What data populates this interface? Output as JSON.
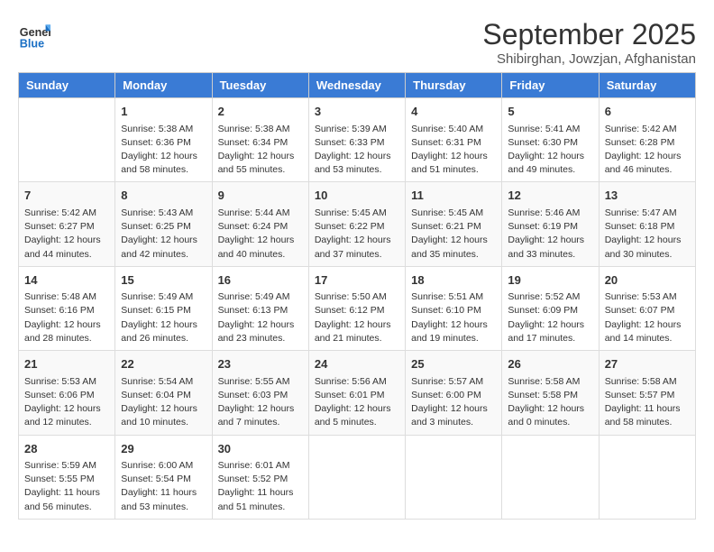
{
  "header": {
    "logo_general": "General",
    "logo_blue": "Blue",
    "month_title": "September 2025",
    "subtitle": "Shibirghan, Jowzjan, Afghanistan"
  },
  "weekdays": [
    "Sunday",
    "Monday",
    "Tuesday",
    "Wednesday",
    "Thursday",
    "Friday",
    "Saturday"
  ],
  "weeks": [
    [
      {
        "day": "",
        "info": ""
      },
      {
        "day": "1",
        "info": "Sunrise: 5:38 AM\nSunset: 6:36 PM\nDaylight: 12 hours\nand 58 minutes."
      },
      {
        "day": "2",
        "info": "Sunrise: 5:38 AM\nSunset: 6:34 PM\nDaylight: 12 hours\nand 55 minutes."
      },
      {
        "day": "3",
        "info": "Sunrise: 5:39 AM\nSunset: 6:33 PM\nDaylight: 12 hours\nand 53 minutes."
      },
      {
        "day": "4",
        "info": "Sunrise: 5:40 AM\nSunset: 6:31 PM\nDaylight: 12 hours\nand 51 minutes."
      },
      {
        "day": "5",
        "info": "Sunrise: 5:41 AM\nSunset: 6:30 PM\nDaylight: 12 hours\nand 49 minutes."
      },
      {
        "day": "6",
        "info": "Sunrise: 5:42 AM\nSunset: 6:28 PM\nDaylight: 12 hours\nand 46 minutes."
      }
    ],
    [
      {
        "day": "7",
        "info": "Sunrise: 5:42 AM\nSunset: 6:27 PM\nDaylight: 12 hours\nand 44 minutes."
      },
      {
        "day": "8",
        "info": "Sunrise: 5:43 AM\nSunset: 6:25 PM\nDaylight: 12 hours\nand 42 minutes."
      },
      {
        "day": "9",
        "info": "Sunrise: 5:44 AM\nSunset: 6:24 PM\nDaylight: 12 hours\nand 40 minutes."
      },
      {
        "day": "10",
        "info": "Sunrise: 5:45 AM\nSunset: 6:22 PM\nDaylight: 12 hours\nand 37 minutes."
      },
      {
        "day": "11",
        "info": "Sunrise: 5:45 AM\nSunset: 6:21 PM\nDaylight: 12 hours\nand 35 minutes."
      },
      {
        "day": "12",
        "info": "Sunrise: 5:46 AM\nSunset: 6:19 PM\nDaylight: 12 hours\nand 33 minutes."
      },
      {
        "day": "13",
        "info": "Sunrise: 5:47 AM\nSunset: 6:18 PM\nDaylight: 12 hours\nand 30 minutes."
      }
    ],
    [
      {
        "day": "14",
        "info": "Sunrise: 5:48 AM\nSunset: 6:16 PM\nDaylight: 12 hours\nand 28 minutes."
      },
      {
        "day": "15",
        "info": "Sunrise: 5:49 AM\nSunset: 6:15 PM\nDaylight: 12 hours\nand 26 minutes."
      },
      {
        "day": "16",
        "info": "Sunrise: 5:49 AM\nSunset: 6:13 PM\nDaylight: 12 hours\nand 23 minutes."
      },
      {
        "day": "17",
        "info": "Sunrise: 5:50 AM\nSunset: 6:12 PM\nDaylight: 12 hours\nand 21 minutes."
      },
      {
        "day": "18",
        "info": "Sunrise: 5:51 AM\nSunset: 6:10 PM\nDaylight: 12 hours\nand 19 minutes."
      },
      {
        "day": "19",
        "info": "Sunrise: 5:52 AM\nSunset: 6:09 PM\nDaylight: 12 hours\nand 17 minutes."
      },
      {
        "day": "20",
        "info": "Sunrise: 5:53 AM\nSunset: 6:07 PM\nDaylight: 12 hours\nand 14 minutes."
      }
    ],
    [
      {
        "day": "21",
        "info": "Sunrise: 5:53 AM\nSunset: 6:06 PM\nDaylight: 12 hours\nand 12 minutes."
      },
      {
        "day": "22",
        "info": "Sunrise: 5:54 AM\nSunset: 6:04 PM\nDaylight: 12 hours\nand 10 minutes."
      },
      {
        "day": "23",
        "info": "Sunrise: 5:55 AM\nSunset: 6:03 PM\nDaylight: 12 hours\nand 7 minutes."
      },
      {
        "day": "24",
        "info": "Sunrise: 5:56 AM\nSunset: 6:01 PM\nDaylight: 12 hours\nand 5 minutes."
      },
      {
        "day": "25",
        "info": "Sunrise: 5:57 AM\nSunset: 6:00 PM\nDaylight: 12 hours\nand 3 minutes."
      },
      {
        "day": "26",
        "info": "Sunrise: 5:58 AM\nSunset: 5:58 PM\nDaylight: 12 hours\nand 0 minutes."
      },
      {
        "day": "27",
        "info": "Sunrise: 5:58 AM\nSunset: 5:57 PM\nDaylight: 11 hours\nand 58 minutes."
      }
    ],
    [
      {
        "day": "28",
        "info": "Sunrise: 5:59 AM\nSunset: 5:55 PM\nDaylight: 11 hours\nand 56 minutes."
      },
      {
        "day": "29",
        "info": "Sunrise: 6:00 AM\nSunset: 5:54 PM\nDaylight: 11 hours\nand 53 minutes."
      },
      {
        "day": "30",
        "info": "Sunrise: 6:01 AM\nSunset: 5:52 PM\nDaylight: 11 hours\nand 51 minutes."
      },
      {
        "day": "",
        "info": ""
      },
      {
        "day": "",
        "info": ""
      },
      {
        "day": "",
        "info": ""
      },
      {
        "day": "",
        "info": ""
      }
    ]
  ]
}
